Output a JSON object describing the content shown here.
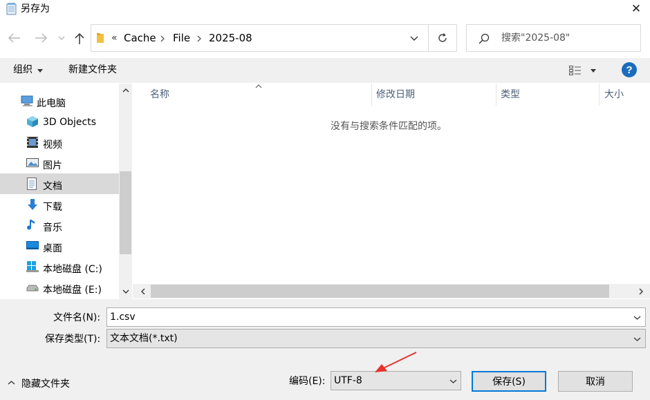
{
  "dialog": {
    "title": "另存为",
    "close_glyph": "✕"
  },
  "nav": {
    "path": [
      "«",
      "Cache",
      "File",
      "2025-08"
    ],
    "search_placeholder": "搜索\"2025-08\""
  },
  "toolbar": {
    "organize_label": "组织",
    "new_folder_label": "新建文件夹",
    "help_label": "?"
  },
  "sidebar": {
    "items": [
      {
        "label": "此电脑",
        "icon": "computer-icon",
        "selected": false
      },
      {
        "label": "3D Objects",
        "icon": "3d-objects-icon",
        "selected": false
      },
      {
        "label": "视频",
        "icon": "video-icon",
        "selected": false
      },
      {
        "label": "图片",
        "icon": "picture-icon",
        "selected": false
      },
      {
        "label": "文档",
        "icon": "document-icon",
        "selected": true
      },
      {
        "label": "下载",
        "icon": "download-icon",
        "selected": false
      },
      {
        "label": "音乐",
        "icon": "music-icon",
        "selected": false
      },
      {
        "label": "桌面",
        "icon": "desktop-icon",
        "selected": false
      },
      {
        "label": "本地磁盘 (C:)",
        "icon": "drive-c-icon",
        "selected": false
      },
      {
        "label": "本地磁盘 (E:)",
        "icon": "drive-e-icon",
        "selected": false
      }
    ]
  },
  "files": {
    "columns": [
      "名称",
      "修改日期",
      "类型",
      "大小"
    ],
    "empty_message": "没有与搜索条件匹配的项。"
  },
  "form": {
    "filename_label": "文件名(N):",
    "filename_value": "1.csv",
    "filetype_label": "保存类型(T):",
    "filetype_value": "文本文档(*.txt)",
    "encoding_label": "编码(E):",
    "encoding_value": "UTF-8",
    "hide_folders_label": "隐藏文件夹",
    "save_label": "保存(S)",
    "cancel_label": "取消"
  },
  "colors": {
    "accent": "#0078d7",
    "arrow": "#e8322d",
    "folder": "#f3c042"
  }
}
